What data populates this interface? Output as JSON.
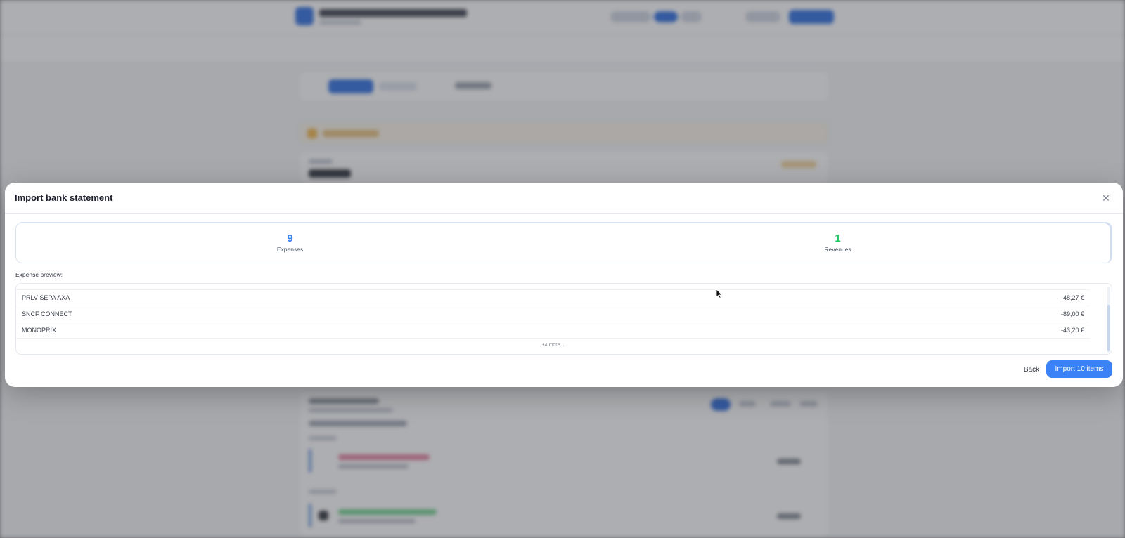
{
  "modal": {
    "title": "Import bank statement",
    "summary": {
      "expenses": {
        "count": "9",
        "label": "Expenses"
      },
      "revenues": {
        "count": "1",
        "label": "Revenues"
      }
    },
    "preview_label": "Expense preview:",
    "rows": [
      {
        "name": "PRLV SEPA AXA",
        "amount": "-48,27 €"
      },
      {
        "name": "SNCF CONNECT",
        "amount": "-89,00 €"
      },
      {
        "name": "MONOPRIX",
        "amount": "-43,20 €"
      }
    ],
    "more_text": "+4 more...",
    "back_label": "Back",
    "import_label": "Import 10 items"
  },
  "colors": {
    "accent": "#3b82f6",
    "expense": "#3b82f6",
    "revenue": "#22c55e"
  }
}
